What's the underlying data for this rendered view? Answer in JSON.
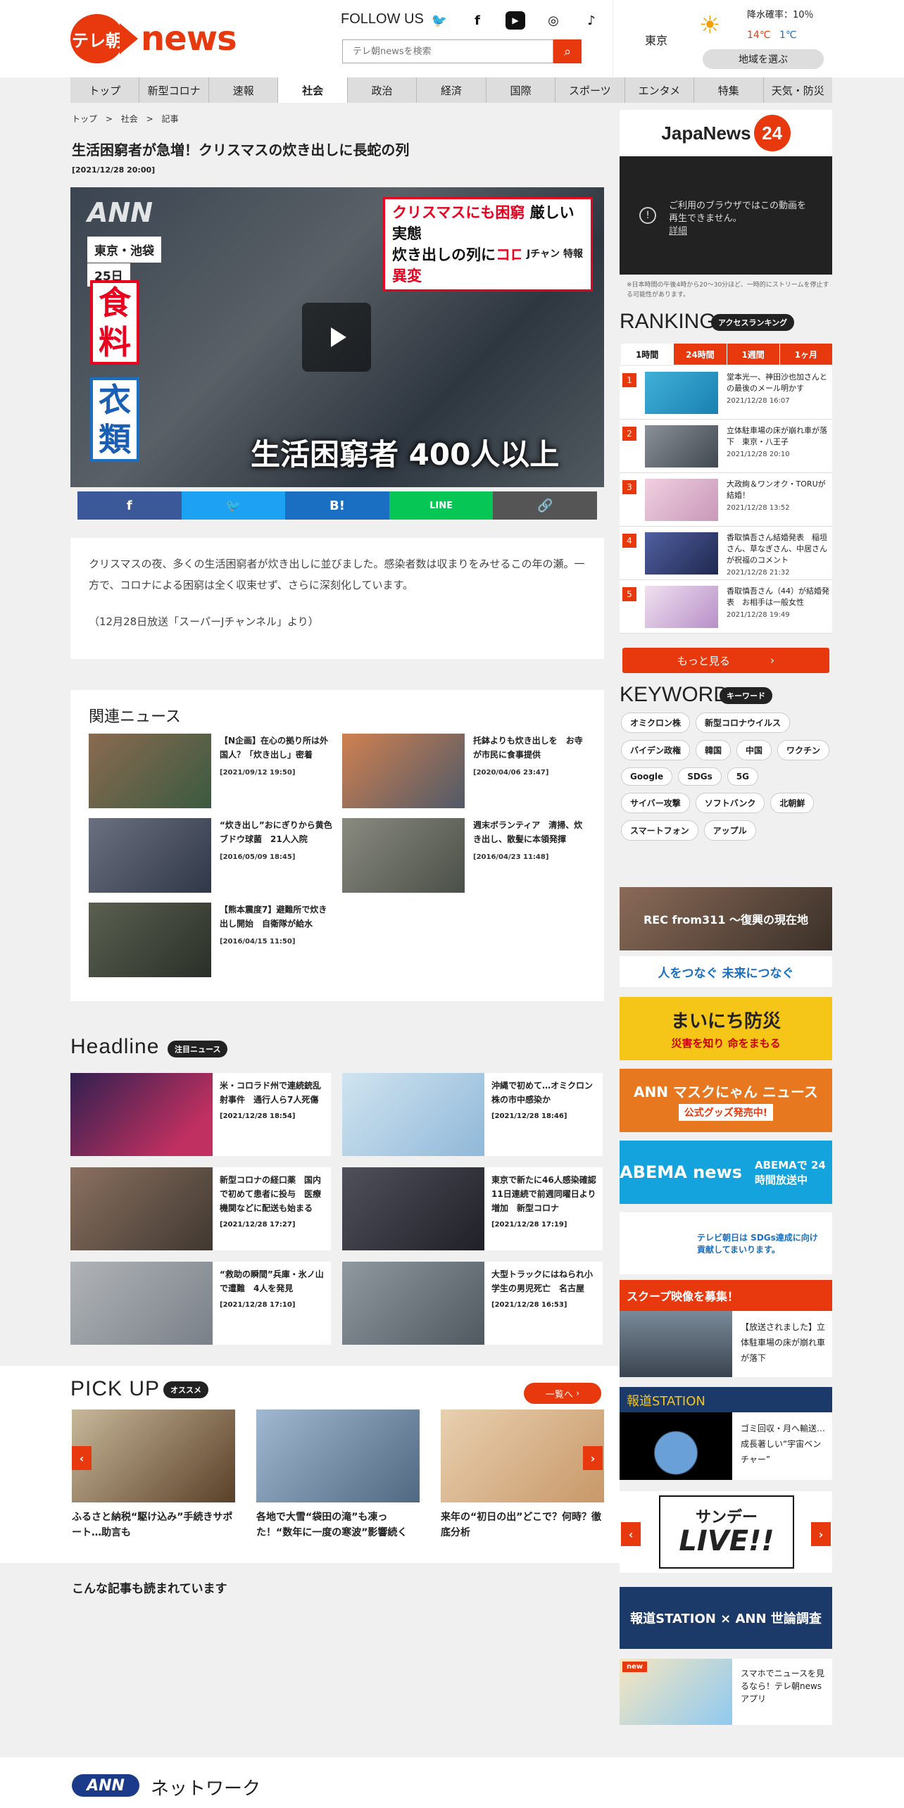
{
  "header": {
    "logo_text": "テレ朝",
    "logo_news": "news",
    "follow_us": "FOLLOW US",
    "search_placeholder": "テレ朝newsを検索",
    "weather": {
      "city": "東京",
      "rain": "降水確率：10％",
      "high": "14℃",
      "low": "1℃",
      "region_button": "地域を選ぶ"
    }
  },
  "nav": [
    "トップ",
    "新型コロナ",
    "速報",
    "社会",
    "政治",
    "経済",
    "国際",
    "スポーツ",
    "エンタメ",
    "特集",
    "天気・防災"
  ],
  "breadcrumb": [
    "トップ",
    ">",
    "社会",
    ">",
    "記事"
  ],
  "article": {
    "title": "生活困窮者が急増！クリスマスの炊き出しに長蛇の列",
    "date": "[2021/12/28 20:00]",
    "video": {
      "logo": "ANN",
      "location": "東京・池袋",
      "day": "25日",
      "vertical_red": "食料",
      "vertical_blue": "衣類",
      "top_line1_red": "クリスマスにも困窮",
      "top_line1_dark": " 厳しい実態",
      "top_line2_dark": "炊き出しの列に",
      "top_line2_red": "コロナ禍の異変",
      "special": "Jチャン 特報",
      "caption": "生活困窮者 400人以上"
    },
    "share": [
      "f",
      "🐦",
      "B!",
      "LINE",
      "🔗"
    ],
    "body": "クリスマスの夜、多くの生活困窮者が炊き出しに並びました。感染者数は収まりをみせるこの年の瀬。一方で、コロナによる困窮は全く収束せず、さらに深刻化しています。",
    "source": "（12月28日放送「スーパーJチャンネル」より）"
  },
  "related": {
    "title": "関連ニュース",
    "items": [
      {
        "title": "【N企画】在心の拠り所は外国人？「炊き出し」密着",
        "date": "[2021/09/12 19:50]"
      },
      {
        "title": "托鉢よりも炊き出しを　お寺が市民に食事提供",
        "date": "[2020/04/06 23:47]"
      },
      {
        "title": "“炊き出し”おにぎりから黄色ブドウ球菌　21人入院",
        "date": "[2016/05/09 18:45]"
      },
      {
        "title": "週末ボランティア　清掃、炊き出し、散髪に本領発揮",
        "date": "[2016/04/23 11:48]"
      },
      {
        "title": "【熊本震度7】避難所で炊き出し開始　自衛隊が給水",
        "date": "[2016/04/15 11:50]"
      }
    ]
  },
  "headline": {
    "title": "Headline",
    "badge": "注目ニュース",
    "items": [
      {
        "title": "米・コロラド州で連続銃乱射事件　通行人ら7人死傷",
        "date": "[2021/12/28 18:54]"
      },
      {
        "title": "沖縄で初めて…オミクロン株の市中感染か",
        "date": "[2021/12/28 18:46]"
      },
      {
        "title": "新型コロナの経口薬　国内で初めて患者に投与　医療機関などに配送も始まる",
        "date": "[2021/12/28 17:27]"
      },
      {
        "title": "東京で新たに46人感染確認　11日連続で前週同曜日より増加　新型コロナ",
        "date": "[2021/12/28 17:19]"
      },
      {
        "title": "“救助の瞬間”兵庫・氷ノ山で遭難　4人を発見",
        "date": "[2021/12/28 17:10]"
      },
      {
        "title": "大型トラックにはねられ小学生の男児死亡　名古屋",
        "date": "[2021/12/28 16:53]"
      }
    ]
  },
  "pickup": {
    "title": "PICK UP",
    "badge": "オススメ",
    "list_button": "一覧へ",
    "items": [
      {
        "title": "ふるさと納税“駆け込み”手続きサポート…助言も"
      },
      {
        "title": "各地で大雪“袋田の滝”も凍った！“数年に一度の寒波”影響続く"
      },
      {
        "title": "来年の“初日の出”どこで？何時？徹底分析"
      }
    ]
  },
  "also_read": "こんな記事も読まれています",
  "footer": {
    "ann": "ANN",
    "network": "ネットワーク"
  },
  "sidebar": {
    "japanews": "JapaNews",
    "japanews_num": "24",
    "video_error": "ご利用のブラウザではこの動画を再生できません。",
    "video_error_link": "詳細",
    "video_note": "※日本時間の午後4時から20～30分ほど、一時的にストリームを停止する可能性があります。",
    "ranking": {
      "title": "RANKING",
      "badge": "アクセスランキング",
      "tabs": [
        "1時間",
        "24時間",
        "1週間",
        "1ヶ月"
      ],
      "items": [
        {
          "num": "1",
          "title": "堂本光一、神田沙也加さんとの最後のメール明かす",
          "date": "2021/12/28 16:07"
        },
        {
          "num": "2",
          "title": "立体駐車場の床が崩れ車が落下　東京・八王子",
          "date": "2021/12/28 20:10"
        },
        {
          "num": "3",
          "title": "大政絢＆ワンオク・TORUが結婚！",
          "date": "2021/12/28 13:52"
        },
        {
          "num": "4",
          "title": "香取慎吾さん結婚発表　稲垣さん、草なぎさん、中居さんが祝福のコメント",
          "date": "2021/12/28 21:32"
        },
        {
          "num": "5",
          "title": "香取慎吾さん（44）が結婚発表　お相手は一般女性",
          "date": "2021/12/28 19:49"
        }
      ],
      "more": "もっと見る"
    },
    "keyword": {
      "title": "KEYWORD",
      "badge": "キーワード",
      "items": [
        "オミクロン株",
        "新型コロナウイルス",
        "バイデン政権",
        "韓国",
        "中国",
        "ワクチン",
        "Google",
        "SDGs",
        "5G",
        "サイバー攻撃",
        "ソフトバンク",
        "北朝鮮",
        "スマートフォン",
        "アップル"
      ]
    },
    "ads": {
      "rec311": "REC from311 ～復興の現在地",
      "sdgs": "人をつなぐ 未来につなぐ",
      "bosai_title": "まいにち防災",
      "bosai_sub": "災害を知り 命をまもる",
      "maskunyan": "ANN マスクにゃん ニュース",
      "maskunyan_sub": "公式グッズ発売中!",
      "abema": "ABEMA news",
      "abema_sub": "ABEMAで 24時間放送中",
      "sdgs2": "テレビ朝日は SDGs達成に向け 貢献してまいります。",
      "pickup_head": "スクープ映像を募集！",
      "pickup_text": "【放送されました】立体駐車場の床が崩れ車が落下",
      "hodo_head": "報道STATION",
      "hodo_text": "ゴミ回収・月へ輸送…成長著しい“宇宙ベンチャー”",
      "live_1": "サンデー",
      "live_2": "LIVE!!",
      "hodo_ann": "報道STATION × ANN 世論調査",
      "app_new": "new",
      "app_text": "スマホでニュースを見るなら！テレ朝newsアプリ"
    }
  }
}
